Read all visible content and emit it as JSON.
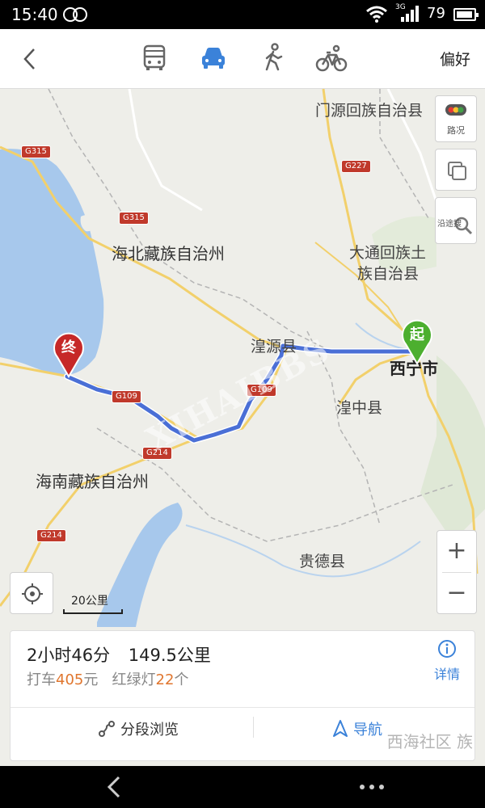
{
  "status_bar": {
    "time": "15:40",
    "network_type": "3G",
    "battery_percent": "79"
  },
  "top_bar": {
    "back_icon": "chevron-left-icon",
    "modes": [
      {
        "name": "bus",
        "icon": "bus-icon",
        "active": false
      },
      {
        "name": "car",
        "icon": "car-icon",
        "active": true
      },
      {
        "name": "walk",
        "icon": "walk-icon",
        "active": false
      },
      {
        "name": "bike",
        "icon": "bike-icon",
        "active": false
      }
    ],
    "preference_label": "偏好"
  },
  "map": {
    "places": {
      "menyuan": "门源回族自治县",
      "haibei": "海北藏族自治州",
      "datong_line1": "大通回族土",
      "datong_line2": "族自治县",
      "huangyuan": "湟源县",
      "xining": "西宁市",
      "huangzhong": "湟中县",
      "hainan": "海南藏族自治州",
      "guide": "贵德县"
    },
    "roads": {
      "g315_a": "G315",
      "g315_b": "G315",
      "g227": "G227",
      "g109_a": "G109",
      "g109_b": "G109",
      "g214_a": "G214",
      "g214_b": "G214"
    },
    "start_marker": "起",
    "end_marker": "终",
    "traffic_button_label": "路况",
    "along_search_label": "沿途搜",
    "zoom_in": "+",
    "zoom_out": "−",
    "scale_label": "20公里",
    "watermark": "XIHAIBBS",
    "colors": {
      "route": "#4a6fd6",
      "start_pin": "#4caf2f",
      "end_pin": "#c62828",
      "lake": "#a7c8ec",
      "highway": "#f2d06b",
      "accent": "#3b82d9",
      "price": "#e0762e"
    }
  },
  "route_card": {
    "duration": "2小时46分",
    "distance": "149.5公里",
    "taxi_prefix": "打车",
    "taxi_price": "405",
    "taxi_unit": "元",
    "lights_prefix": "红绿灯",
    "lights_count": "22",
    "lights_unit": "个",
    "details_label": "详情",
    "segments_label": "分段浏览",
    "navigate_label": "导航",
    "corner_watermark": "西海社区 族"
  },
  "system_nav": {
    "back_icon": "back-icon",
    "more_icon": "more-dots-icon"
  }
}
